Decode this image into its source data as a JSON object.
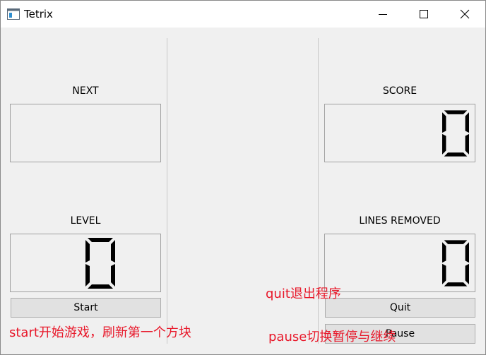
{
  "window": {
    "title": "Tetrix",
    "icons": {
      "app": "app-window-icon",
      "minimize": "minimize-icon",
      "maximize": "maximize-icon",
      "close": "close-icon"
    }
  },
  "left_panel": {
    "next_label": "NEXT",
    "level_label": "LEVEL",
    "level_value": "0",
    "start_label": "Start"
  },
  "right_panel": {
    "score_label": "SCORE",
    "score_value": "0",
    "lines_label": "LINES REMOVED",
    "lines_value": "0",
    "quit_label": "Quit",
    "pause_label": "Pause"
  },
  "annotations": {
    "start_note": "start开始游戏，刷新第一个方块",
    "quit_note": "quit退出程序",
    "pause_note": "pause切换暂停与继续"
  },
  "colors": {
    "annotation": "#e8182a",
    "background": "#f0f0f0"
  }
}
